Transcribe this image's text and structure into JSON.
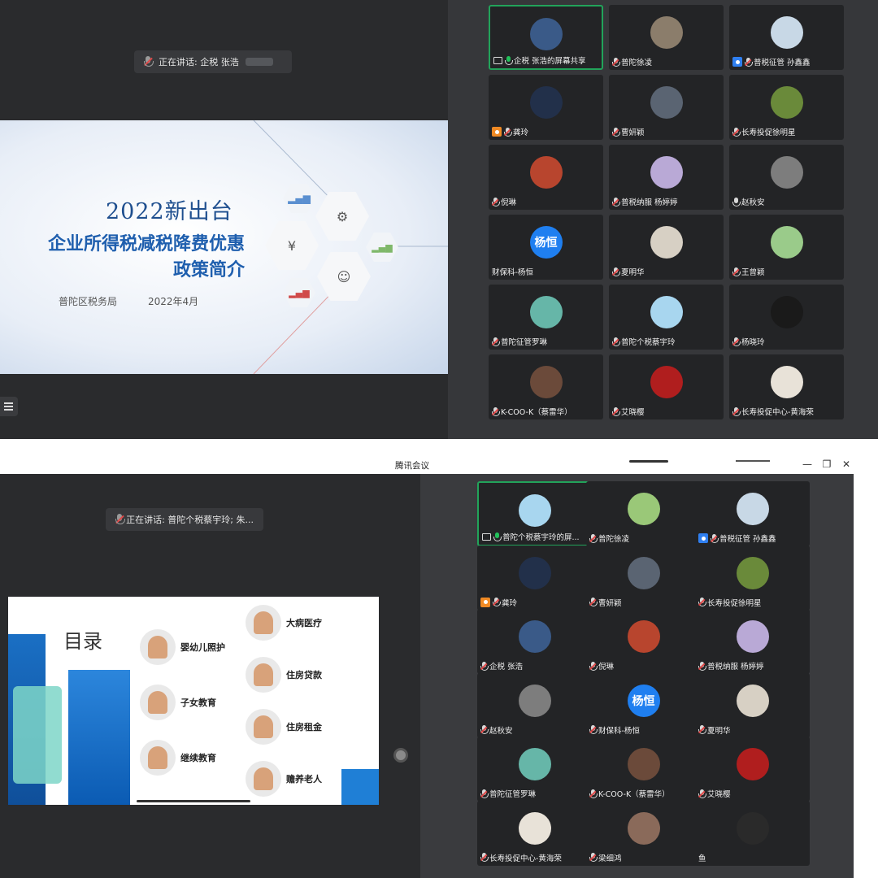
{
  "top": {
    "speaker": {
      "prefix": "正在讲话: 企税 张浩",
      "suffix": ""
    },
    "slide": {
      "year_title": "2022新出台",
      "title_line1": "企业所得税减税降费优惠",
      "title_line2": "政策简介",
      "bureau": "普陀区税务局",
      "date": "2022年4月"
    },
    "participants": [
      {
        "label": "企税 张浩的屏幕共享",
        "mic": "on",
        "share": true,
        "active": true,
        "avatar": "#3a5a88"
      },
      {
        "label": "普陀徐凌",
        "mic": "muted",
        "avatar": "#8b7d6b"
      },
      {
        "label": "普税征管 孙鑫鑫",
        "mic": "muted",
        "host": "#2f7ff0",
        "avatar": "#c8d8e6"
      },
      {
        "label": "龚玲",
        "mic": "muted",
        "host": "#f08a24",
        "avatar": "#22304a"
      },
      {
        "label": "曹妍颖",
        "mic": "muted",
        "avatar": "#5a6472"
      },
      {
        "label": "长寿投促徐明星",
        "mic": "muted",
        "avatar": "#6a8a3a"
      },
      {
        "label": "倪琳",
        "mic": "muted",
        "avatar": "#b8452e"
      },
      {
        "label": "普税纳服 杨婷婷",
        "mic": "muted",
        "avatar": "#b9a9d6"
      },
      {
        "label": "赵秋安",
        "mic": "off",
        "avatar": "#7d7d7d"
      },
      {
        "label": "财保科-杨恒",
        "mic": "none",
        "avatar_text": "杨恒"
      },
      {
        "label": "夏明华",
        "mic": "muted",
        "avatar": "#d7d0c4"
      },
      {
        "label": "王曾颖",
        "mic": "muted",
        "avatar": "#9acb8a"
      },
      {
        "label": "普陀征管罗琳",
        "mic": "muted",
        "avatar": "#66b6a8"
      },
      {
        "label": "普陀个税蔡宇玲",
        "mic": "muted",
        "avatar": "#a8d6ef"
      },
      {
        "label": "杨晓玲",
        "mic": "muted",
        "avatar": "#1a1a1a"
      },
      {
        "label": "K-COO-K（蔡雷华）",
        "mic": "muted",
        "avatar": "#6b4a3a"
      },
      {
        "label": "艾晓樱",
        "mic": "muted",
        "avatar": "#b01e1e"
      },
      {
        "label": "长寿投促中心-黄海荣",
        "mic": "muted",
        "avatar": "#e8e2d8"
      }
    ]
  },
  "bottom": {
    "window_title": "腾讯会议",
    "speaker": {
      "prefix": "正在讲话: 普陀个税蔡宇玲; 朱..."
    },
    "slide": {
      "title": "目录",
      "items": [
        {
          "label": "婴幼儿照护"
        },
        {
          "label": "子女教育"
        },
        {
          "label": "继续教育"
        },
        {
          "label": "大病医疗"
        },
        {
          "label": "住房贷款"
        },
        {
          "label": "住房租金"
        },
        {
          "label": "赡养老人"
        }
      ]
    },
    "participants": [
      {
        "label": "普陀个税蔡宇玲的屏...",
        "mic": "on",
        "share": true,
        "active": true,
        "avatar": "#a8d6ef"
      },
      {
        "label": "普陀徐凌",
        "mic": "muted",
        "avatar": "#9ac878"
      },
      {
        "label": "普税征管 孙鑫鑫",
        "mic": "muted",
        "host": "#2f7ff0",
        "avatar": "#c8d8e6"
      },
      {
        "label": "龚玲",
        "mic": "muted",
        "host": "#f08a24",
        "avatar": "#22304a"
      },
      {
        "label": "曹妍颖",
        "mic": "muted",
        "avatar": "#5a6472"
      },
      {
        "label": "长寿投促徐明星",
        "mic": "muted",
        "avatar": "#6a8a3a"
      },
      {
        "label": "企税 张浩",
        "mic": "muted",
        "avatar": "#3a5a88"
      },
      {
        "label": "倪琳",
        "mic": "muted",
        "avatar": "#b8452e"
      },
      {
        "label": "普税纳服 杨婷婷",
        "mic": "muted",
        "avatar": "#b9a9d6"
      },
      {
        "label": "赵秋安",
        "mic": "muted",
        "avatar": "#7d7d7d"
      },
      {
        "label": "财保科-杨恒",
        "mic": "muted",
        "avatar_text": "杨恒"
      },
      {
        "label": "夏明华",
        "mic": "muted",
        "avatar": "#d7d0c4"
      },
      {
        "label": "普陀征管罗琳",
        "mic": "muted",
        "avatar": "#66b6a8"
      },
      {
        "label": "K-COO-K（蔡雷华）",
        "mic": "muted",
        "avatar": "#6b4a3a"
      },
      {
        "label": "艾晓樱",
        "mic": "muted",
        "avatar": "#b01e1e"
      },
      {
        "label": "长寿投促中心-黄海荣",
        "mic": "muted",
        "avatar": "#e8e2d8"
      },
      {
        "label": "梁细鸿",
        "mic": "muted",
        "avatar": "#8a6a5a"
      },
      {
        "label": "鱼",
        "mic": "none",
        "avatar": "#2a2a2a"
      }
    ]
  }
}
